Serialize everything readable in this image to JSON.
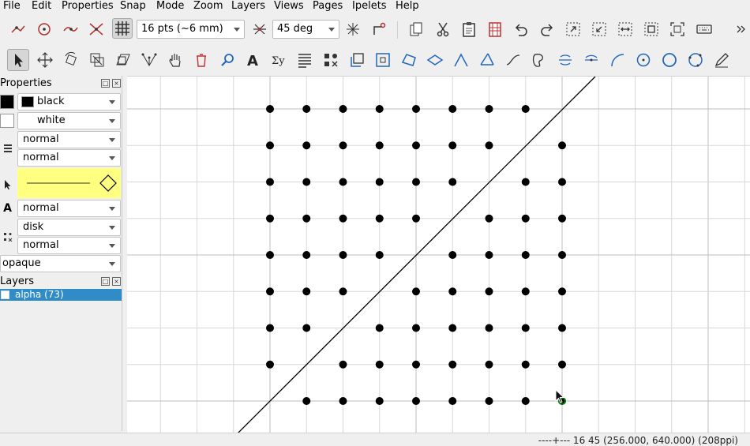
{
  "menu": {
    "items": [
      {
        "label": "File",
        "key": "F"
      },
      {
        "label": "Edit",
        "key": "E"
      },
      {
        "label": "Properties",
        "key": "P"
      },
      {
        "label": "Snap",
        "key": "S"
      },
      {
        "label": "Mode",
        "key": "M"
      },
      {
        "label": "Zoom",
        "key": "Z"
      },
      {
        "label": "Layers",
        "key": "L"
      },
      {
        "label": "Views",
        "key": "V"
      },
      {
        "label": "Pages",
        "key": "P"
      },
      {
        "label": "Ipelets",
        "key": "I"
      },
      {
        "label": "Help",
        "key": "H"
      }
    ]
  },
  "toolbar1": {
    "grid_size": "16 pts (~6 mm)",
    "angle_size": "45 deg"
  },
  "properties": {
    "title": "Properties",
    "stroke_color": "black",
    "fill_color": "white",
    "pen": "normal",
    "dash": "normal",
    "text_size": "normal",
    "mark_shape": "disk",
    "mark_size": "normal",
    "opacity": "opaque"
  },
  "layers": {
    "title": "Layers",
    "items": [
      {
        "label": "alpha (73)",
        "checked": true
      }
    ]
  },
  "status": {
    "text": "----+--- 16 45 (256.000, 640.000) (208ppi)"
  },
  "colors": {
    "layer_highlight": "#308cc6",
    "arrow_fill": "#ffff80",
    "grid_line": "#d8d8d8",
    "grid_line_major": "#bdbdbd",
    "mark": "#000000",
    "snap_marker": "#009000"
  },
  "canvas": {
    "marks": {
      "columns": 9,
      "rows": 9,
      "missing": [
        [
          8,
          0
        ],
        [
          7,
          1
        ],
        [
          6,
          2
        ],
        [
          5,
          3
        ],
        [
          4,
          4
        ],
        [
          3,
          5
        ],
        [
          2,
          6
        ],
        [
          1,
          7
        ],
        [
          0,
          8
        ]
      ]
    }
  }
}
